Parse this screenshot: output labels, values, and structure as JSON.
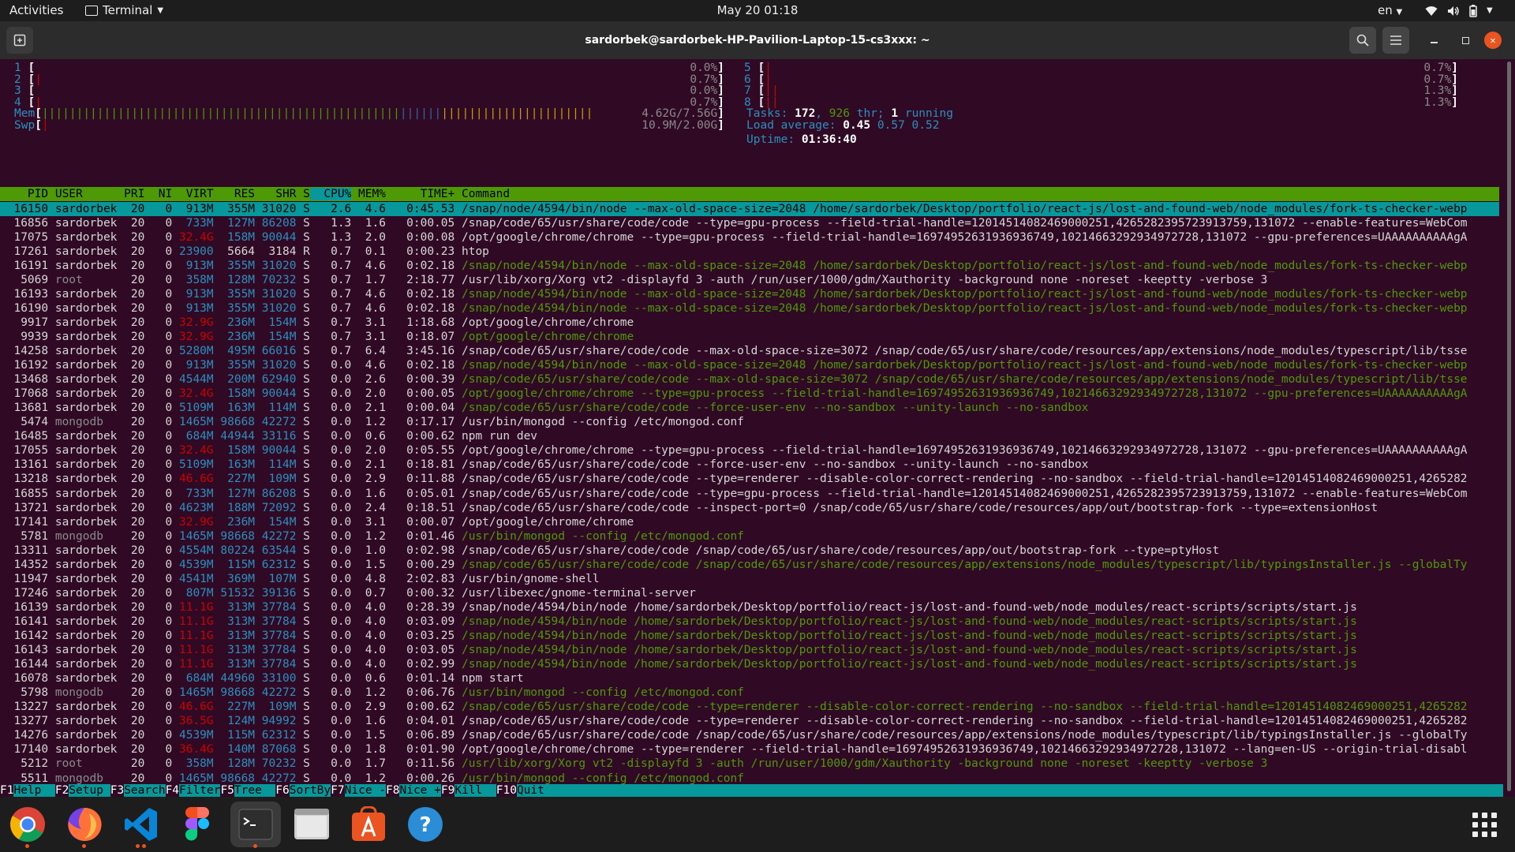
{
  "topbar": {
    "activities": "Activities",
    "app_name": "Terminal",
    "clock": "May 20  01:18",
    "lang": "en"
  },
  "window": {
    "title": "sardorbek@sardorbek-HP-Pavilion-Laptop-15-cs3xxx: ~"
  },
  "htop": {
    "cpus_left": [
      {
        "n": "1",
        "pct": "0.0%"
      },
      {
        "n": "2",
        "pct": "0.7%"
      },
      {
        "n": "3",
        "pct": "0.0%"
      },
      {
        "n": "4",
        "pct": "0.7%"
      }
    ],
    "cpus_right": [
      {
        "n": "5",
        "pct": "0.7%"
      },
      {
        "n": "6",
        "pct": "0.7%"
      },
      {
        "n": "7",
        "pct": "1.3%"
      },
      {
        "n": "8",
        "pct": "1.3%"
      }
    ],
    "mem_label": "Mem",
    "mem_value": "4.62G/7.56G",
    "swp_label": "Swp",
    "swp_value": "10.9M/2.00G",
    "tasks_label": "Tasks:",
    "tasks_count": "172",
    "tasks_thr": "926",
    "tasks_thr_label": "thr;",
    "tasks_running": "1",
    "tasks_running_label": "running",
    "load_label": "Load average:",
    "load_1": "0.45",
    "load_5": "0.57",
    "load_15": "0.52",
    "uptime_label": "Uptime:",
    "uptime": "01:36:40",
    "columns": [
      "PID",
      "USER",
      "PRI",
      "NI",
      "VIRT",
      "RES",
      "SHR",
      "S",
      "CPU%",
      "MEM%",
      "TIME+",
      "Command"
    ],
    "processes": [
      [
        "16150",
        "sardorbek",
        "20",
        "0",
        "913M",
        "355M",
        "31020",
        "S",
        "2.6",
        "4.6",
        "0:45.53",
        "/snap/node/4594/bin/node --max-old-space-size=2048 /home/sardorbek/Desktop/portfolio/react-js/lost-and-found-web/node_modules/fork-ts-checker-webp"
      ],
      [
        "16856",
        "sardorbek",
        "20",
        "0",
        "733M",
        "127M",
        "86208",
        "S",
        "1.3",
        "1.6",
        "0:00.05",
        "/snap/code/65/usr/share/code/code --type=gpu-process --field-trial-handle=12014514082469000251,4265282395723913759,131072 --enable-features=WebCom"
      ],
      [
        "17075",
        "sardorbek",
        "20",
        "0",
        "32.4G",
        "158M",
        "90044",
        "S",
        "1.3",
        "2.0",
        "0:00.08",
        "/opt/google/chrome/chrome --type=gpu-process --field-trial-handle=16974952631936936749,10214663292934972728,131072 --gpu-preferences=UAAAAAAAAAAgA"
      ],
      [
        "17261",
        "sardorbek",
        "20",
        "0",
        "23900",
        "5664",
        "3184",
        "R",
        "0.7",
        "0.1",
        "0:00.23",
        "htop"
      ],
      [
        "16191",
        "sardorbek",
        "20",
        "0",
        "913M",
        "355M",
        "31020",
        "S",
        "0.7",
        "4.6",
        "0:02.18",
        "/snap/node/4594/bin/node --max-old-space-size=2048 /home/sardorbek/Desktop/portfolio/react-js/lost-and-found-web/node_modules/fork-ts-checker-webp"
      ],
      [
        "5069",
        "root",
        "20",
        "0",
        "358M",
        "128M",
        "70232",
        "S",
        "0.7",
        "1.7",
        "2:18.77",
        "/usr/lib/xorg/Xorg vt2 -displayfd 3 -auth /run/user/1000/gdm/Xauthority -background none -noreset -keeptty -verbose 3"
      ],
      [
        "16193",
        "sardorbek",
        "20",
        "0",
        "913M",
        "355M",
        "31020",
        "S",
        "0.7",
        "4.6",
        "0:02.18",
        "/snap/node/4594/bin/node --max-old-space-size=2048 /home/sardorbek/Desktop/portfolio/react-js/lost-and-found-web/node_modules/fork-ts-checker-webp"
      ],
      [
        "16190",
        "sardorbek",
        "20",
        "0",
        "913M",
        "355M",
        "31020",
        "S",
        "0.7",
        "4.6",
        "0:02.18",
        "/snap/node/4594/bin/node --max-old-space-size=2048 /home/sardorbek/Desktop/portfolio/react-js/lost-and-found-web/node_modules/fork-ts-checker-webp"
      ],
      [
        "9917",
        "sardorbek",
        "20",
        "0",
        "32.9G",
        "236M",
        "154M",
        "S",
        "0.7",
        "3.1",
        "1:18.68",
        "/opt/google/chrome/chrome"
      ],
      [
        "9939",
        "sardorbek",
        "20",
        "0",
        "32.9G",
        "236M",
        "154M",
        "S",
        "0.7",
        "3.1",
        "0:18.07",
        "/opt/google/chrome/chrome"
      ],
      [
        "14258",
        "sardorbek",
        "20",
        "0",
        "5280M",
        "495M",
        "66016",
        "S",
        "0.7",
        "6.4",
        "3:45.16",
        "/snap/code/65/usr/share/code/code --max-old-space-size=3072 /snap/code/65/usr/share/code/resources/app/extensions/node_modules/typescript/lib/tsse"
      ],
      [
        "16192",
        "sardorbek",
        "20",
        "0",
        "913M",
        "355M",
        "31020",
        "S",
        "0.0",
        "4.6",
        "0:02.18",
        "/snap/node/4594/bin/node --max-old-space-size=2048 /home/sardorbek/Desktop/portfolio/react-js/lost-and-found-web/node_modules/fork-ts-checker-webp"
      ],
      [
        "13468",
        "sardorbek",
        "20",
        "0",
        "4544M",
        "200M",
        "62940",
        "S",
        "0.0",
        "2.6",
        "0:00.39",
        "/snap/code/65/usr/share/code/code --max-old-space-size=3072 /snap/code/65/usr/share/code/resources/app/extensions/node_modules/typescript/lib/tsse"
      ],
      [
        "17068",
        "sardorbek",
        "20",
        "0",
        "32.4G",
        "158M",
        "90044",
        "S",
        "0.0",
        "2.0",
        "0:00.05",
        "/opt/google/chrome/chrome --type=gpu-process --field-trial-handle=16974952631936936749,10214663292934972728,131072 --gpu-preferences=UAAAAAAAAAAgA"
      ],
      [
        "13681",
        "sardorbek",
        "20",
        "0",
        "5109M",
        "163M",
        "114M",
        "S",
        "0.0",
        "2.1",
        "0:00.04",
        "/snap/code/65/usr/share/code/code --force-user-env --no-sandbox --unity-launch --no-sandbox"
      ],
      [
        "5474",
        "mongodb",
        "20",
        "0",
        "1465M",
        "98668",
        "42272",
        "S",
        "0.0",
        "1.2",
        "0:17.17",
        "/usr/bin/mongod --config /etc/mongod.conf"
      ],
      [
        "16485",
        "sardorbek",
        "20",
        "0",
        "684M",
        "44944",
        "33116",
        "S",
        "0.0",
        "0.6",
        "0:00.62",
        "npm run dev"
      ],
      [
        "17055",
        "sardorbek",
        "20",
        "0",
        "32.4G",
        "158M",
        "90044",
        "S",
        "0.0",
        "2.0",
        "0:05.55",
        "/opt/google/chrome/chrome --type=gpu-process --field-trial-handle=16974952631936936749,10214663292934972728,131072 --gpu-preferences=UAAAAAAAAAAgA"
      ],
      [
        "13161",
        "sardorbek",
        "20",
        "0",
        "5109M",
        "163M",
        "114M",
        "S",
        "0.0",
        "2.1",
        "0:18.81",
        "/snap/code/65/usr/share/code/code --force-user-env --no-sandbox --unity-launch --no-sandbox"
      ],
      [
        "13218",
        "sardorbek",
        "20",
        "0",
        "46.6G",
        "227M",
        "109M",
        "S",
        "0.0",
        "2.9",
        "0:11.88",
        "/snap/code/65/usr/share/code/code --type=renderer --disable-color-correct-rendering --no-sandbox --field-trial-handle=12014514082469000251,4265282"
      ],
      [
        "16855",
        "sardorbek",
        "20",
        "0",
        "733M",
        "127M",
        "86208",
        "S",
        "0.0",
        "1.6",
        "0:05.01",
        "/snap/code/65/usr/share/code/code --type=gpu-process --field-trial-handle=12014514082469000251,4265282395723913759,131072 --enable-features=WebCom"
      ],
      [
        "13721",
        "sardorbek",
        "20",
        "0",
        "4623M",
        "188M",
        "72092",
        "S",
        "0.0",
        "2.4",
        "0:18.51",
        "/snap/code/65/usr/share/code/code --inspect-port=0 /snap/code/65/usr/share/code/resources/app/out/bootstrap-fork --type=extensionHost"
      ],
      [
        "17141",
        "sardorbek",
        "20",
        "0",
        "32.9G",
        "236M",
        "154M",
        "S",
        "0.0",
        "3.1",
        "0:00.07",
        "/opt/google/chrome/chrome"
      ],
      [
        "5781",
        "mongodb",
        "20",
        "0",
        "1465M",
        "98668",
        "42272",
        "S",
        "0.0",
        "1.2",
        "0:01.46",
        "/usr/bin/mongod --config /etc/mongod.conf"
      ],
      [
        "13311",
        "sardorbek",
        "20",
        "0",
        "4554M",
        "80224",
        "63544",
        "S",
        "0.0",
        "1.0",
        "0:02.98",
        "/snap/code/65/usr/share/code/code /snap/code/65/usr/share/code/resources/app/out/bootstrap-fork --type=ptyHost"
      ],
      [
        "14352",
        "sardorbek",
        "20",
        "0",
        "4539M",
        "115M",
        "62312",
        "S",
        "0.0",
        "1.5",
        "0:00.29",
        "/snap/code/65/usr/share/code/code /snap/code/65/usr/share/code/resources/app/extensions/node_modules/typescript/lib/typingsInstaller.js --globalTy"
      ],
      [
        "11947",
        "sardorbek",
        "20",
        "0",
        "4541M",
        "369M",
        "107M",
        "S",
        "0.0",
        "4.8",
        "2:02.83",
        "/usr/bin/gnome-shell"
      ],
      [
        "17246",
        "sardorbek",
        "20",
        "0",
        "807M",
        "51532",
        "39136",
        "S",
        "0.0",
        "0.7",
        "0:00.32",
        "/usr/libexec/gnome-terminal-server"
      ],
      [
        "16139",
        "sardorbek",
        "20",
        "0",
        "11.1G",
        "313M",
        "37784",
        "S",
        "0.0",
        "4.0",
        "0:28.39",
        "/snap/node/4594/bin/node /home/sardorbek/Desktop/portfolio/react-js/lost-and-found-web/node_modules/react-scripts/scripts/start.js"
      ],
      [
        "16141",
        "sardorbek",
        "20",
        "0",
        "11.1G",
        "313M",
        "37784",
        "S",
        "0.0",
        "4.0",
        "0:03.09",
        "/snap/node/4594/bin/node /home/sardorbek/Desktop/portfolio/react-js/lost-and-found-web/node_modules/react-scripts/scripts/start.js"
      ],
      [
        "16142",
        "sardorbek",
        "20",
        "0",
        "11.1G",
        "313M",
        "37784",
        "S",
        "0.0",
        "4.0",
        "0:03.25",
        "/snap/node/4594/bin/node /home/sardorbek/Desktop/portfolio/react-js/lost-and-found-web/node_modules/react-scripts/scripts/start.js"
      ],
      [
        "16143",
        "sardorbek",
        "20",
        "0",
        "11.1G",
        "313M",
        "37784",
        "S",
        "0.0",
        "4.0",
        "0:03.05",
        "/snap/node/4594/bin/node /home/sardorbek/Desktop/portfolio/react-js/lost-and-found-web/node_modules/react-scripts/scripts/start.js"
      ],
      [
        "16144",
        "sardorbek",
        "20",
        "0",
        "11.1G",
        "313M",
        "37784",
        "S",
        "0.0",
        "4.0",
        "0:02.99",
        "/snap/node/4594/bin/node /home/sardorbek/Desktop/portfolio/react-js/lost-and-found-web/node_modules/react-scripts/scripts/start.js"
      ],
      [
        "16078",
        "sardorbek",
        "20",
        "0",
        "684M",
        "44960",
        "33100",
        "S",
        "0.0",
        "0.6",
        "0:01.14",
        "npm start"
      ],
      [
        "5798",
        "mongodb",
        "20",
        "0",
        "1465M",
        "98668",
        "42272",
        "S",
        "0.0",
        "1.2",
        "0:06.76",
        "/usr/bin/mongod --config /etc/mongod.conf"
      ],
      [
        "13227",
        "sardorbek",
        "20",
        "0",
        "46.6G",
        "227M",
        "109M",
        "S",
        "0.0",
        "2.9",
        "0:00.62",
        "/snap/code/65/usr/share/code/code --type=renderer --disable-color-correct-rendering --no-sandbox --field-trial-handle=12014514082469000251,4265282"
      ],
      [
        "13277",
        "sardorbek",
        "20",
        "0",
        "36.5G",
        "124M",
        "94992",
        "S",
        "0.0",
        "1.6",
        "0:04.01",
        "/snap/code/65/usr/share/code/code --type=renderer --disable-color-correct-rendering --no-sandbox --field-trial-handle=12014514082469000251,4265282"
      ],
      [
        "14276",
        "sardorbek",
        "20",
        "0",
        "4539M",
        "115M",
        "62312",
        "S",
        "0.0",
        "1.5",
        "0:06.89",
        "/snap/code/65/usr/share/code/code /snap/code/65/usr/share/code/resources/app/extensions/node_modules/typescript/lib/typingsInstaller.js --globalTy"
      ],
      [
        "17140",
        "sardorbek",
        "20",
        "0",
        "36.4G",
        "140M",
        "87068",
        "S",
        "0.0",
        "1.8",
        "0:01.90",
        "/opt/google/chrome/chrome --type=renderer --field-trial-handle=16974952631936936749,10214663292934972728,131072 --lang=en-US --origin-trial-disabl"
      ],
      [
        "5212",
        "root",
        "20",
        "0",
        "358M",
        "128M",
        "70232",
        "S",
        "0.0",
        "1.7",
        "0:11.56",
        "/usr/lib/xorg/Xorg vt2 -displayfd 3 -auth /run/user/1000/gdm/Xauthority -background none -noreset -keeptty -verbose 3"
      ],
      [
        "5511",
        "mongodb",
        "20",
        "0",
        "1465M",
        "98668",
        "42272",
        "S",
        "0.0",
        "1.2",
        "0:00.26",
        "/usr/bin/mongod --config /etc/mongod.conf"
      ]
    ],
    "thread_rows": [
      "16191",
      "16193",
      "16190",
      "9939",
      "16192",
      "13468",
      "17068",
      "13681",
      "5781",
      "14352",
      "16141",
      "16142",
      "16143",
      "16144",
      "5798",
      "13227",
      "5212",
      "5511"
    ],
    "fkeys": [
      {
        "key": "F1",
        "label": "Help  "
      },
      {
        "key": "F2",
        "label": "Setup "
      },
      {
        "key": "F3",
        "label": "Search"
      },
      {
        "key": "F4",
        "label": "Filter"
      },
      {
        "key": "F5",
        "label": "Tree  "
      },
      {
        "key": "F6",
        "label": "SortBy"
      },
      {
        "key": "F7",
        "label": "Nice -"
      },
      {
        "key": "F8",
        "label": "Nice +"
      },
      {
        "key": "F9",
        "label": "Kill  "
      },
      {
        "key": "F10",
        "label": "Quit"
      }
    ]
  },
  "dock": {
    "items": [
      "chrome-icon",
      "firefox-icon",
      "vscode-icon",
      "figma-icon",
      "terminal-icon",
      "files-icon",
      "software-icon",
      "help-icon"
    ]
  },
  "colors": {
    "terminal_bg": "#300a24",
    "header_green": "#4e9a06",
    "selection_cyan": "#06989a",
    "close_orange": "#e95420"
  }
}
